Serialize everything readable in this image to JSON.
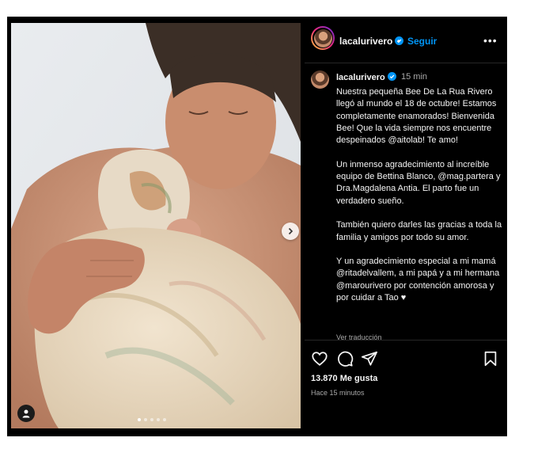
{
  "post": {
    "username": "lacalurivero",
    "follow_label": "Seguir",
    "separator": "•",
    "more_label": "•••",
    "time_short": "15 min",
    "caption_paragraphs": [
      "Nuestra pequeña Bee De La Rua Rivero llegó al mundo el 18 de octubre! Estamos completamente enamorados! Bienvenida Bee! Que la vida siempre nos encuentre despeinados @aitolab! Te amo!",
      "Un inmenso agradecimiento al increíble equipo de Bettina Blanco, @mag.partera y Dra.Magdalena Antia. El parto fue un verdadero sueño.",
      "También quiero darles las gracias a toda la familia y amigos por todo su amor.",
      "Y un agradecimiento especial a mi mamá @ritadelvallem, a mi papá y a mi hermana @marourivero por contención amorosa y por cuidar a Tao ♥"
    ],
    "see_translation": "Ver traducción",
    "likes": "13.870 Me gusta",
    "time_ago": "Hace 15 minutos"
  },
  "carousel": {
    "dots": 5,
    "active_index": 0
  },
  "icons": {
    "verified": "verified-badge-icon",
    "like": "heart-icon",
    "comment": "comment-icon",
    "share": "send-icon",
    "save": "bookmark-icon",
    "next": "chevron-right-icon",
    "tag": "user-tag-icon"
  },
  "colors": {
    "accent": "#0095f6",
    "background": "#000000",
    "text": "#f5f5f5",
    "muted": "#a8a8a8"
  }
}
